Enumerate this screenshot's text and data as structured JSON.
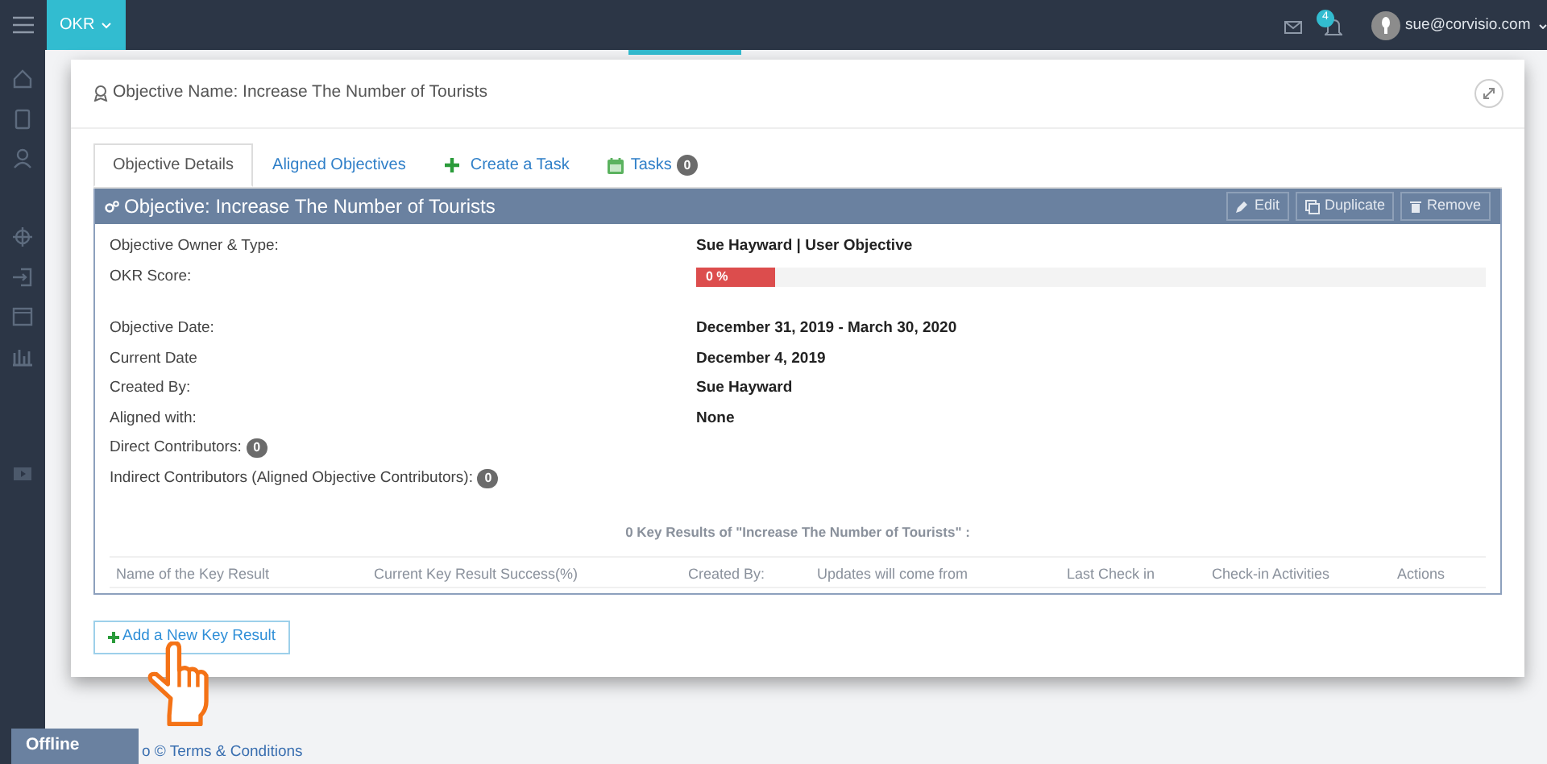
{
  "topbar": {
    "app_menu": "OKR",
    "notification_count": "4",
    "user": "sue@corvisio.com"
  },
  "modal": {
    "title": "Objective Name: Increase The Number of Tourists",
    "tabs": [
      {
        "label": "Objective Details",
        "selected": true,
        "kind": "plain"
      },
      {
        "label": "Aligned Objectives",
        "selected": false,
        "kind": "plain"
      },
      {
        "label": "Create a Task",
        "selected": false,
        "kind": "plus"
      },
      {
        "label": "Tasks",
        "selected": false,
        "kind": "calendar",
        "badge": "0"
      }
    ],
    "panel": {
      "title": "Objective: Increase The Number of Tourists",
      "actions": [
        {
          "label": "Edit",
          "kind": "edit"
        },
        {
          "label": "Duplicate",
          "kind": "duplicate"
        },
        {
          "label": "Remove",
          "kind": "remove"
        }
      ],
      "fields": [
        {
          "kind": "text",
          "label": "Objective Owner & Type:",
          "value": "Sue Hayward | User Objective"
        },
        {
          "kind": "progress",
          "label": "OKR Score:",
          "value": "0 %",
          "level": 0.1
        },
        {
          "kind": "text",
          "label": "Objective Date:",
          "value": "December 31, 2019 - March 30, 2020"
        },
        {
          "kind": "text",
          "label": "Current Date",
          "value": "December 4, 2019"
        },
        {
          "kind": "text",
          "label": "Created By:",
          "value": "Sue Hayward"
        },
        {
          "kind": "text",
          "label": "Aligned with:",
          "value": "None"
        },
        {
          "kind": "badge",
          "label": "Direct Contributors:",
          "value": "0"
        },
        {
          "kind": "badge",
          "label": "Indirect Contributors (Aligned Objective Contributors):",
          "value": "0"
        }
      ],
      "key_results": {
        "caption": "0 Key Results of \"Increase The Number of Tourists\" :",
        "columns": [
          "Name of the Key Result",
          "Current Key Result Success(%)",
          "Created By:",
          "Updates will come from",
          "Last Check in",
          "Check-in Activities",
          "Actions"
        ]
      }
    },
    "add_button": "Add a New Key Result"
  },
  "footer": {
    "text": "o © Terms & Conditions",
    "status_badge": "Offline"
  }
}
